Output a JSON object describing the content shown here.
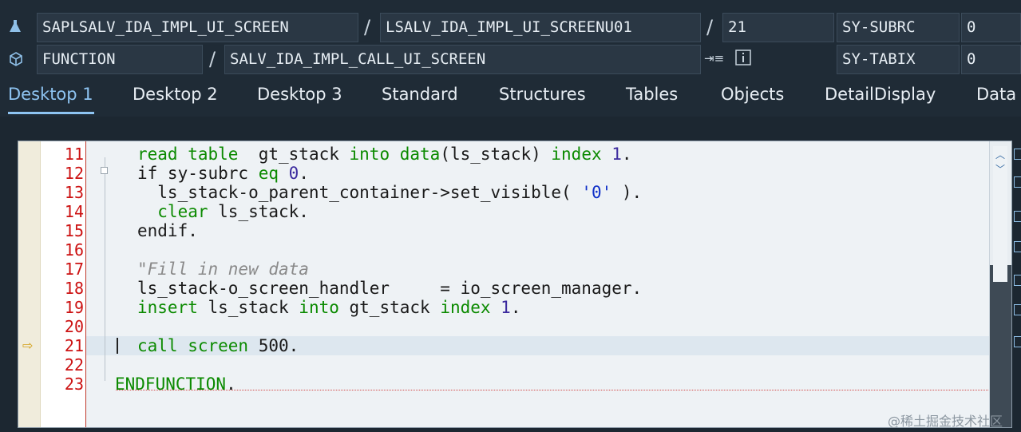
{
  "header": {
    "row1": {
      "program": "SAPLSALV_IDA_IMPL_UI_SCREEN",
      "include": "LSALV_IDA_IMPL_UI_SCREENU01",
      "line": "21",
      "sysvar_name": "SY-SUBRC",
      "sysvar_value": "0"
    },
    "row2": {
      "event_type": "FUNCTION",
      "event_name": "SALV_IDA_IMPL_CALL_UI_SCREEN",
      "sysvar_name": "SY-TABIX",
      "sysvar_value": "0"
    },
    "separator": "/"
  },
  "tabs": [
    {
      "label": "Desktop 1",
      "active": true
    },
    {
      "label": "Desktop 2",
      "active": false
    },
    {
      "label": "Desktop 3",
      "active": false
    },
    {
      "label": "Standard",
      "active": false
    },
    {
      "label": "Structures",
      "active": false
    },
    {
      "label": "Tables",
      "active": false
    },
    {
      "label": "Objects",
      "active": false
    },
    {
      "label": "DetailDisplay",
      "active": false
    },
    {
      "label": "Data",
      "active": false
    }
  ],
  "editor": {
    "current_line": "21",
    "lines": [
      {
        "num": "11",
        "tokens": [
          [
            "kw",
            "read table"
          ],
          [
            "",
            "  gt_stack "
          ],
          [
            "kw",
            "into data"
          ],
          [
            "",
            "(ls_stack) "
          ],
          [
            "kw",
            "index"
          ],
          [
            "num",
            " 1"
          ],
          [
            "",
            "."
          ]
        ]
      },
      {
        "num": "12",
        "tokens": [
          [
            "",
            "if sy-subrc "
          ],
          [
            "kw",
            "eq"
          ],
          [
            "num",
            " 0"
          ],
          [
            "",
            "."
          ]
        ]
      },
      {
        "num": "13",
        "tokens": [
          [
            "",
            "  ls_stack-o_parent_container->set_visible( "
          ],
          [
            "str",
            "'0'"
          ],
          [
            "",
            " )."
          ]
        ]
      },
      {
        "num": "14",
        "tokens": [
          [
            "kw",
            "  clear"
          ],
          [
            "",
            " ls_stack."
          ]
        ]
      },
      {
        "num": "15",
        "tokens": [
          [
            "",
            "endif."
          ]
        ]
      },
      {
        "num": "16",
        "tokens": []
      },
      {
        "num": "17",
        "tokens": [
          [
            "cmt",
            "\"Fill in new data"
          ]
        ]
      },
      {
        "num": "18",
        "tokens": [
          [
            "",
            "ls_stack-o_screen_handler     = io_screen_manager."
          ]
        ]
      },
      {
        "num": "19",
        "tokens": [
          [
            "kw",
            "insert"
          ],
          [
            "",
            " ls_stack "
          ],
          [
            "kw",
            "into"
          ],
          [
            "",
            " gt_stack "
          ],
          [
            "kw",
            "index"
          ],
          [
            "num",
            " 1"
          ],
          [
            "",
            "."
          ]
        ]
      },
      {
        "num": "20",
        "tokens": []
      },
      {
        "num": "21",
        "tokens": [
          [
            "kw",
            "call screen"
          ],
          [
            "",
            " 500."
          ]
        ]
      },
      {
        "num": "22",
        "tokens": []
      },
      {
        "num": "23",
        "tokens": [
          [
            "kw",
            "ENDFUNCTION"
          ],
          [
            "",
            "."
          ]
        ]
      }
    ]
  },
  "watermark": "@稀土掘金技术社区",
  "colors": {
    "keyword": "#0b8a00",
    "number": "#3b2a9e",
    "string": "#1030c8",
    "line_number": "#cc1111",
    "active_tab": "#8ec4f2"
  }
}
